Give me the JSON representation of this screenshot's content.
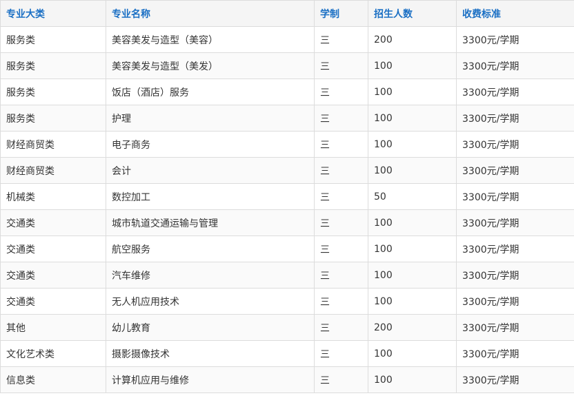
{
  "table": {
    "headers": [
      "专业大类",
      "专业名称",
      "学制",
      "招生人数",
      "收费标准"
    ],
    "rows": [
      [
        "服务类",
        "美容美发与造型（美容）",
        "三",
        "200",
        "3300元/学期"
      ],
      [
        "服务类",
        "美容美发与造型（美发）",
        "三",
        "100",
        "3300元/学期"
      ],
      [
        "服务类",
        "饭店（酒店）服务",
        "三",
        "100",
        "3300元/学期"
      ],
      [
        "服务类",
        "护理",
        "三",
        "100",
        "3300元/学期"
      ],
      [
        "财经商贸类",
        "电子商务",
        "三",
        "100",
        "3300元/学期"
      ],
      [
        "财经商贸类",
        "会计",
        "三",
        "100",
        "3300元/学期"
      ],
      [
        "机械类",
        "数控加工",
        "三",
        "50",
        "3300元/学期"
      ],
      [
        "交通类",
        "城市轨道交通运输与管理",
        "三",
        "100",
        "3300元/学期"
      ],
      [
        "交通类",
        "航空服务",
        "三",
        "100",
        "3300元/学期"
      ],
      [
        "交通类",
        "汽车维修",
        "三",
        "100",
        "3300元/学期"
      ],
      [
        "交通类",
        "无人机应用技术",
        "三",
        "100",
        "3300元/学期"
      ],
      [
        "其他",
        "幼儿教育",
        "三",
        "200",
        "3300元/学期"
      ],
      [
        "文化艺术类",
        "摄影摄像技术",
        "三",
        "100",
        "3300元/学期"
      ],
      [
        "信息类",
        "计算机应用与维修",
        "三",
        "100",
        "3300元/学期"
      ]
    ]
  },
  "colors": {
    "header_text": "#1a6fc4",
    "header_bg": "#f5f5f5",
    "cell_text": "#333333",
    "border": "#dcdcdc"
  }
}
